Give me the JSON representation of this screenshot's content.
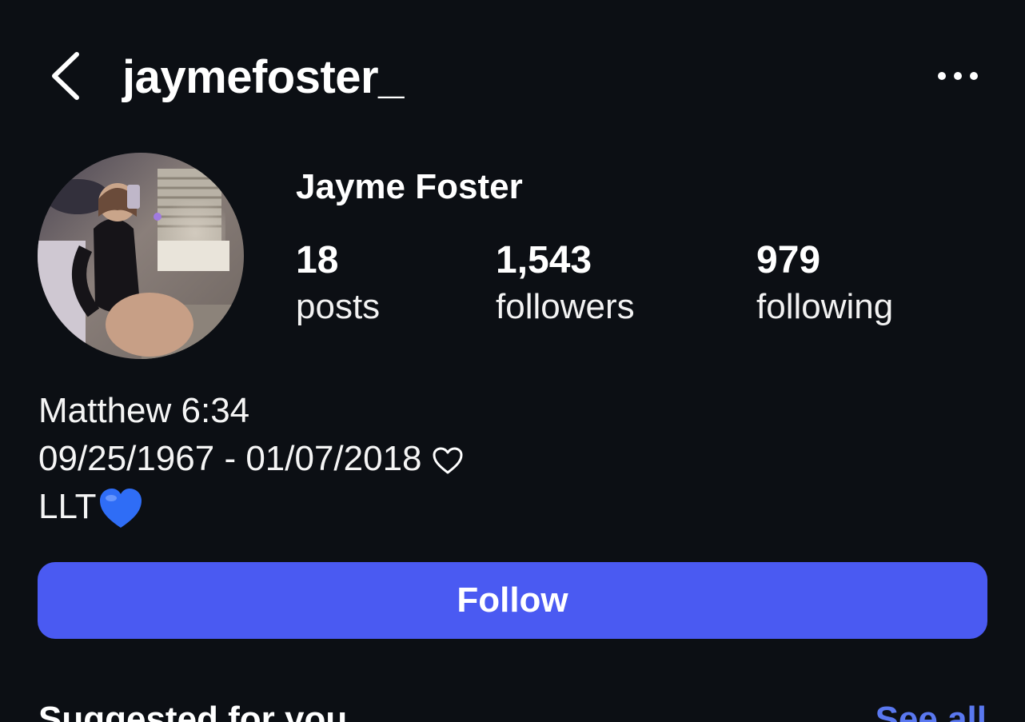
{
  "header": {
    "username": "jaymefoster_",
    "back_icon": "chevron-left-icon",
    "more_icon": "more-horizontal-icon"
  },
  "profile": {
    "display_name": "Jayme Foster",
    "avatar_icon": "profile-photo-avatar"
  },
  "stats": [
    {
      "count": "18",
      "label": "posts"
    },
    {
      "count": "1,543",
      "label": "followers"
    },
    {
      "count": "979",
      "label": "following"
    }
  ],
  "bio": {
    "line1": "Matthew 6:34",
    "line2": "09/25/1967 - 01/07/2018",
    "line2_icon": "heart-outline-icon",
    "line3": "LLT",
    "line3_icon": "blue-heart-emoji"
  },
  "actions": {
    "follow_label": "Follow"
  },
  "suggested": {
    "title": "Suggested for you",
    "see_all_label": "See all"
  },
  "colors": {
    "background": "#0c0f14",
    "follow_button": "#4a5af2",
    "link": "#5a78f0",
    "text": "#ffffff",
    "blue_heart": "#2f6df6"
  }
}
